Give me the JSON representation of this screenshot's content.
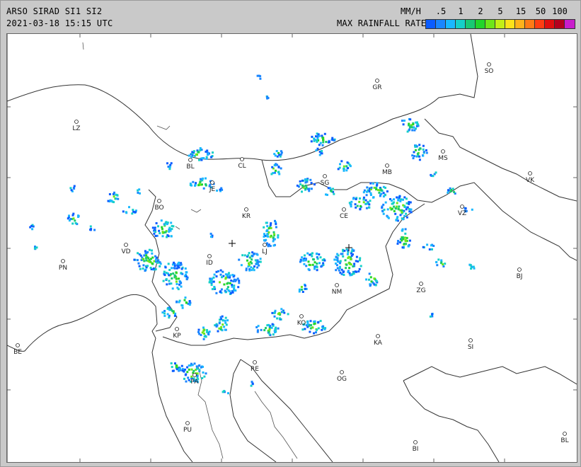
{
  "header": {
    "product_line": "ARSO SIRAD SI1 SI2",
    "datetime_line": "2021-03-18 15:15 UTC",
    "units_label": "MM/H",
    "rate_label": "MAX RAINFALL RATE"
  },
  "legend": {
    "ticks": [
      ".5",
      "1",
      "2",
      "5",
      "15",
      "50",
      "100"
    ],
    "colors": [
      "#0a5cff",
      "#1a86ff",
      "#19b8ff",
      "#15d0c8",
      "#19c973",
      "#22d52a",
      "#6ee619",
      "#c4ef16",
      "#fde21a",
      "#ffb21b",
      "#ff7a16",
      "#ff3d12",
      "#e00f0f",
      "#b4001e",
      "#c81ecb"
    ]
  },
  "stations": [
    {
      "code": "SO"
    },
    {
      "code": "GR"
    },
    {
      "code": "LZ"
    },
    {
      "code": "CL"
    },
    {
      "code": "BL"
    },
    {
      "code": "MB"
    },
    {
      "code": "MS"
    },
    {
      "code": "SG"
    },
    {
      "code": "JE"
    },
    {
      "code": "VK"
    },
    {
      "code": "BO"
    },
    {
      "code": "KR"
    },
    {
      "code": "CE"
    },
    {
      "code": "VZ"
    },
    {
      "code": "LJ"
    },
    {
      "code": "VD"
    },
    {
      "code": "ID"
    },
    {
      "code": "PN"
    },
    {
      "code": "NM"
    },
    {
      "code": "ZG"
    },
    {
      "code": "BJ"
    },
    {
      "code": "KO"
    },
    {
      "code": "KP"
    },
    {
      "code": "KA"
    },
    {
      "code": "SI"
    },
    {
      "code": "RE"
    },
    {
      "code": "OG"
    },
    {
      "code": "PA"
    },
    {
      "code": "PU"
    },
    {
      "code": "BE"
    },
    {
      "code": "BI"
    },
    {
      "code": "BL"
    }
  ]
}
